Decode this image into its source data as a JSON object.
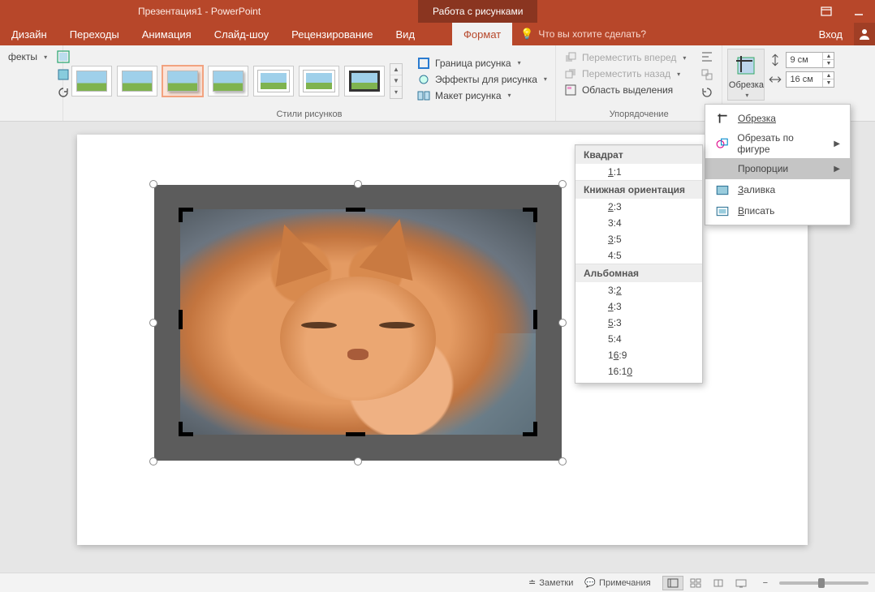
{
  "titlebar": {
    "document_title": "Презентация1 - PowerPoint",
    "context_title": "Работа с рисунками"
  },
  "tabs": {
    "design": "Дизайн",
    "transitions": "Переходы",
    "animation": "Анимация",
    "slideshow": "Слайд-шоу",
    "review": "Рецензирование",
    "view": "Вид",
    "format": "Формат",
    "tell_me_placeholder": "Что вы хотите сделать?",
    "signin": "Вход"
  },
  "ribbon": {
    "effects_split": "фекты",
    "styles_group": "Стили рисунков",
    "border": "Граница рисунка",
    "effects": "Эффекты для рисунка",
    "layout": "Макет рисунка",
    "arrange_group": "Упорядочение",
    "bring_forward": "Переместить вперед",
    "send_backward": "Переместить назад",
    "selection_pane": "Область выделения",
    "crop_label": "Обрезка",
    "height_value": "9 см",
    "width_value": "16 см"
  },
  "crop_menu": {
    "crop": "Обрезка",
    "crop_to_shape": "Обрезать по фигуре",
    "aspect": "Пропорции",
    "fill": "Заливка",
    "fit": "Вписать"
  },
  "aspect": {
    "square_header": "Квадрат",
    "r_1_1": "1:1",
    "portrait_header": "Книжная ориентация",
    "r_2_3": "2:3",
    "r_3_4": "3:4",
    "r_3_5": "3:5",
    "r_4_5": "4:5",
    "landscape_header": "Альбомная",
    "r_3_2": "3:2",
    "r_4_3": "4:3",
    "r_5_3": "5:3",
    "r_5_4": "5:4",
    "r_16_9": "16:9",
    "r_16_10": "16:10"
  },
  "statusbar": {
    "notes": "Заметки",
    "comments": "Примечания"
  }
}
